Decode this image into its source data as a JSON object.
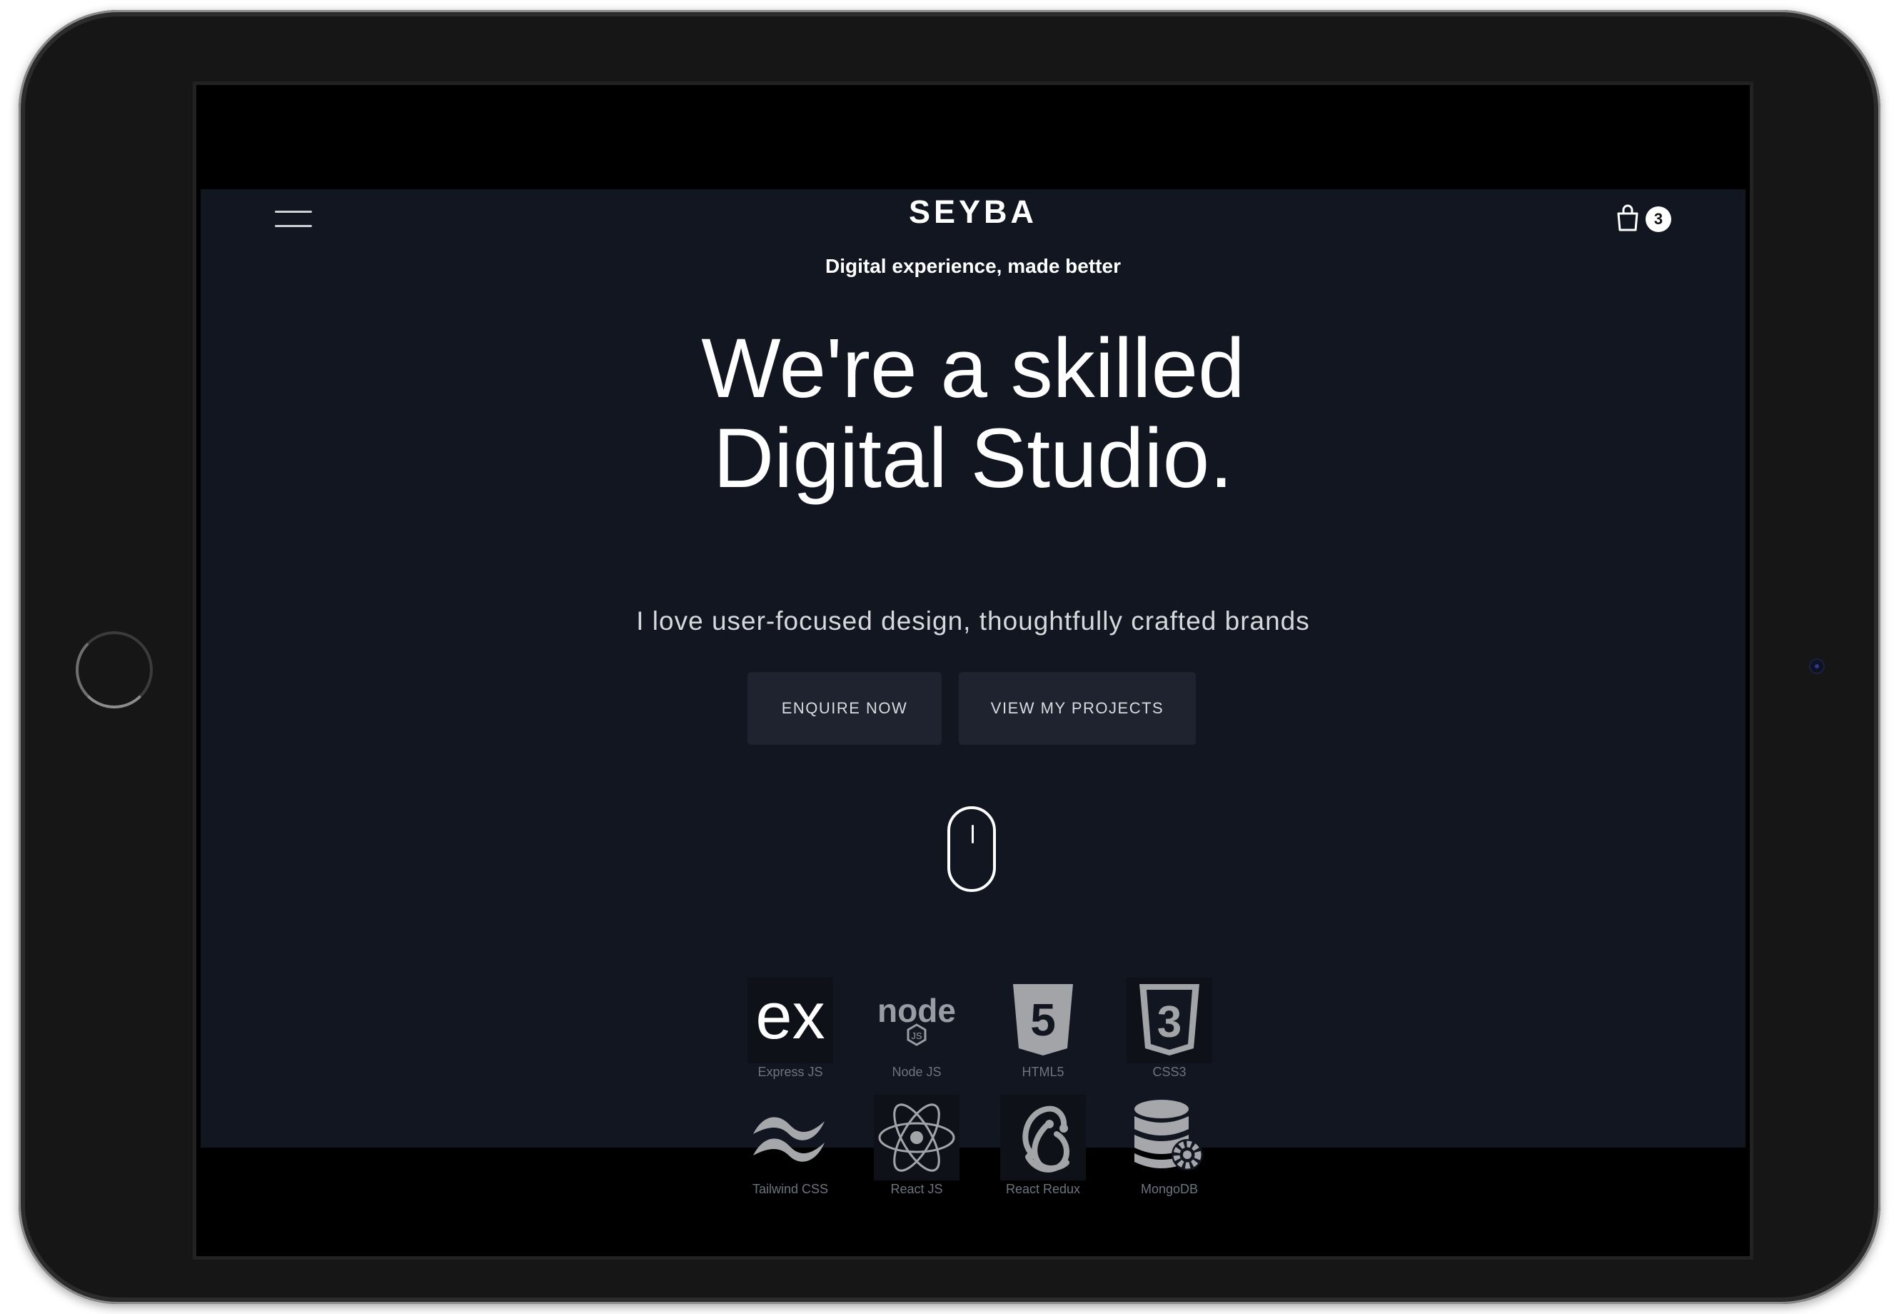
{
  "header": {
    "logo": "SEYBA",
    "tagline": "Digital experience, made better",
    "cart_count": "3"
  },
  "hero": {
    "headline_line1": "We're a skilled",
    "headline_line2": "Digital Studio.",
    "subtitle": "I love user-focused design, thoughtfully crafted brands",
    "primary_button": "ENQUIRE NOW",
    "secondary_button": "VIEW MY PROJECTS"
  },
  "tech_stack": [
    {
      "label": "Express JS",
      "icon": "express-icon"
    },
    {
      "label": "Node JS",
      "icon": "nodejs-icon"
    },
    {
      "label": "HTML5",
      "icon": "html5-icon"
    },
    {
      "label": "CSS3",
      "icon": "css3-icon"
    },
    {
      "label": "Tailwind CSS",
      "icon": "tailwind-icon"
    },
    {
      "label": "React JS",
      "icon": "react-icon"
    },
    {
      "label": "React Redux",
      "icon": "redux-icon"
    },
    {
      "label": "MongoDB",
      "icon": "mongodb-icon"
    }
  ],
  "colors": {
    "page_background": "#121620",
    "button_background": "#1f2330",
    "text": "#ffffff",
    "label_text": "#6e7380"
  }
}
